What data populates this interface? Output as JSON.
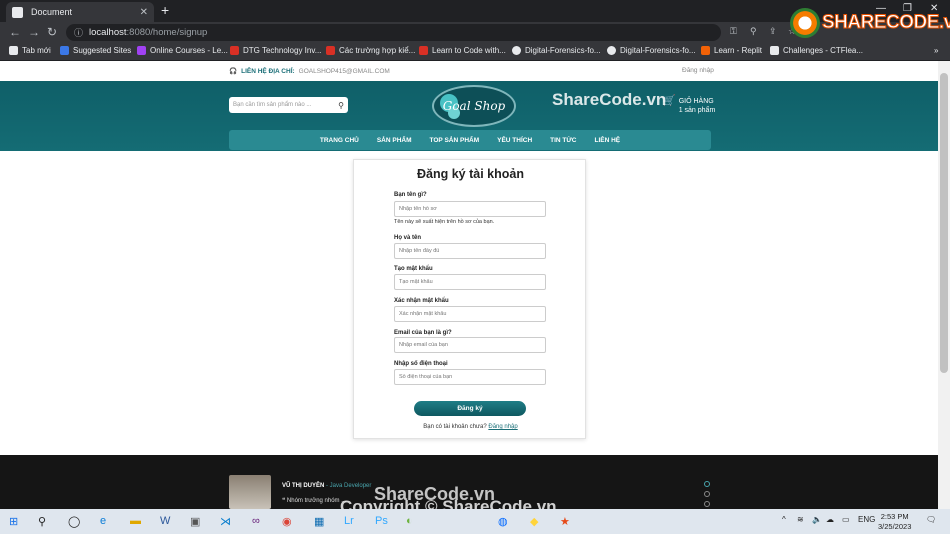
{
  "browser": {
    "tab_title": "Document",
    "url_host": "localhost",
    "url_path": ":8080/home/signup",
    "bookmarks": [
      {
        "label": "Tab mới",
        "color": "#e8eaed"
      },
      {
        "label": "Suggested Sites",
        "color": "#3b78e7"
      },
      {
        "label": "Online Courses - Le...",
        "color": "#a142f4"
      },
      {
        "label": "DTG Technology Inv...",
        "color": "#d93025"
      },
      {
        "label": "Các trường hợp kiể...",
        "color": "#d93025"
      },
      {
        "label": "Learn to Code with...",
        "color": "#d93025"
      },
      {
        "label": "Digital-Forensics-fo...",
        "color": "#e8eaed"
      },
      {
        "label": "Digital-Forensics-fo...",
        "color": "#e8eaed"
      },
      {
        "label": "Learn - Replit",
        "color": "#f26207"
      },
      {
        "label": "Challenges - CTFlea...",
        "color": "#e8eaed"
      }
    ]
  },
  "site": {
    "contact_label": "LIÊN HỆ ĐỊA CHỈ:",
    "contact_email": "GOALSHOP415@GMAIL.COM",
    "login_link": "Đăng nhập",
    "search_placeholder": "Bạn cần tìm sản phẩm nào ...",
    "logo_text": "Goal Shop",
    "cart_line1": "GIỎ HÀNG",
    "cart_line2": "1 sản phẩm",
    "menu": [
      "TRANG CHỦ",
      "SẢN PHẨM",
      "TOP SẢN PHẨM",
      "YÊU THÍCH",
      "TIN TỨC",
      "LIÊN HỆ"
    ]
  },
  "form": {
    "title": "Đăng ký tài khoản",
    "fields": [
      {
        "label": "Bạn tên gì?",
        "placeholder": "Nhập tên hồ sơ"
      },
      {
        "label": "Họ và tên",
        "placeholder": "Nhập tên đầy đủ"
      },
      {
        "label": "Tạo mật khẩu",
        "placeholder": "Tạo mật khẩu"
      },
      {
        "label": "Xác nhận mật khẩu",
        "placeholder": "Xác nhận mật khẩu"
      },
      {
        "label": "Email của bạn là gì?",
        "placeholder": "Nhập email của bạn"
      },
      {
        "label": "Nhập số điện thoại",
        "placeholder": "Số điện thoại của bạn"
      }
    ],
    "name_hint": "Tên này sẽ xuất hiện trên hồ sơ của bạn.",
    "submit_label": "Đăng ký",
    "have_account_text": "Bạn có tài khoản chưa?",
    "have_account_link": "Đăng nhập"
  },
  "footer": {
    "name": "VŨ THỊ DUYÊN",
    "role": "- Java Developer",
    "quote": "Nhóm trưởng nhóm ..."
  },
  "watermark": {
    "logo_text": "SHARECODE.vn",
    "header_text": "ShareCode.vn",
    "footer_text": "ShareCode.vn",
    "copyright_text": "Copyright © ShareCode.vn"
  },
  "taskbar": {
    "lang": "ENG",
    "time": "2:53 PM",
    "date": "3/25/2023"
  }
}
